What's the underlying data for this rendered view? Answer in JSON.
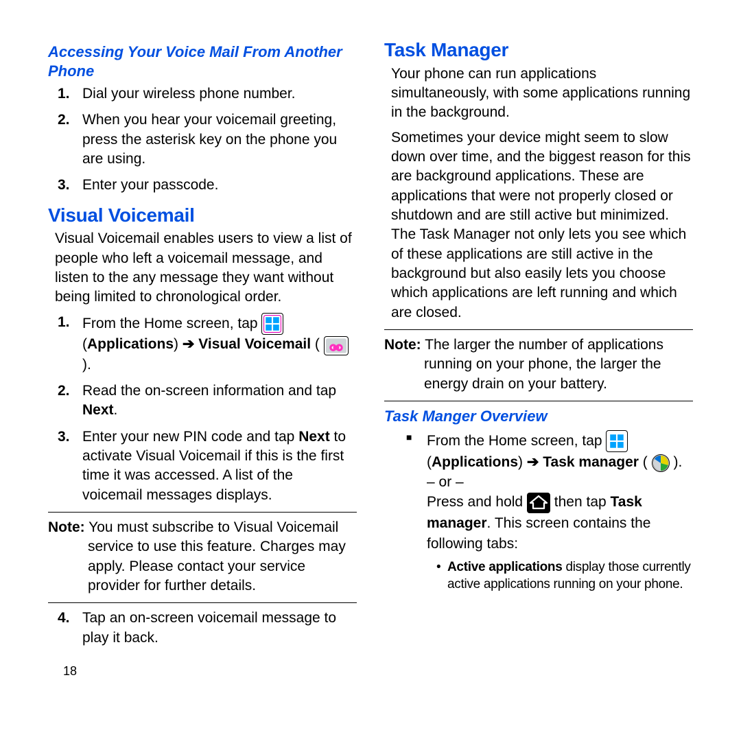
{
  "left": {
    "sub1": "Accessing Your Voice Mail From Another Phone",
    "steps_a": [
      "Dial your wireless phone number.",
      "When you hear your voicemail greeting, press the asterisk key on the phone you are using.",
      "Enter your passcode."
    ],
    "h_vv": "Visual Voicemail",
    "vv_intro": "Visual Voicemail enables users to view a list of people who left a voicemail message, and listen to the any message they want without being limited to chronological order.",
    "vv1_pre": "From the Home screen, tap ",
    "vv1_app_paren_open": "(",
    "vv1_app_label": "Applications",
    "vv1_arrow": " ➔ ",
    "vv1_vv_label": "Visual Voicemail",
    "vv1_post": " ).",
    "vv2_pre": "Read the on-screen information and tap ",
    "vv2_next": "Next",
    "vv2_post": ".",
    "vv3_pre": "Enter your new PIN code and tap ",
    "vv3_next": "Next",
    "vv3_post": " to activate Visual Voicemail if this is the first time it was accessed. A list of the voicemail messages displays.",
    "note1_label": "Note:",
    "note1_body": " You must subscribe to Visual Voicemail service to use this feature. Charges may apply. Please contact your service provider for further details.",
    "vv4": "Tap an on-screen voicemail message to play it back.",
    "page": "18"
  },
  "right": {
    "h_tm": "Task Manager",
    "tm_p1": "Your phone can run applications simultaneously, with some applications running in the background.",
    "tm_p2": "Sometimes your device might seem to slow down over time, and the biggest reason for this are background applications. These are applications that were not properly closed or shutdown and are still active but minimized. The Task Manager not only lets you see which of these applications are still active in the background but also easily lets you choose which applications are left running and which are closed.",
    "note2_label": "Note:",
    "note2_body": " The larger the number of applications running on your phone, the larger the energy drain on your battery.",
    "sub2": "Task Manger Overview",
    "tmo_pre": "From the Home screen, tap ",
    "tmo_app_paren_open": "(",
    "tmo_app_label": "Applications",
    "tmo_arrow": " ➔ ",
    "tmo_tm_label": "Task manager",
    "tmo_post": " ).",
    "tmo_or": "– or –",
    "tmo2_pre": "Press and hold ",
    "tmo2_mid": " then tap ",
    "tmo2_tm": "Task manager",
    "tmo2_post": ". This screen contains the following tabs:",
    "bullet_b": "Active applications",
    "bullet_rest": " display those currently active applications running on your phone."
  }
}
